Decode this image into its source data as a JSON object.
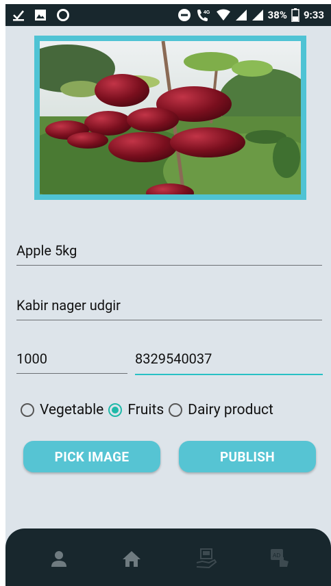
{
  "status_bar": {
    "battery_percent": "38%",
    "time": "9:33",
    "network": "4G",
    "icons_left": [
      "checkbox-download-icon",
      "image-icon",
      "circle-icon"
    ],
    "icons_right": [
      "do-not-disturb-icon",
      "call-4g-icon",
      "wifi-icon",
      "signal-icon",
      "signal-icon-2",
      "battery-icon"
    ]
  },
  "product_image": {
    "icon": "apple-photo"
  },
  "form": {
    "title_value": "Apple 5kg",
    "address_value": "Kabir nager udgir",
    "price_value": "1000",
    "phone_value": "8329540037"
  },
  "categories": {
    "options": [
      "Vegetable",
      "Fruits",
      "Dairy product"
    ],
    "selected": "Fruits"
  },
  "buttons": {
    "pick_image": "PICK IMAGE",
    "publish": "PUBLISH"
  },
  "bottom_nav": {
    "items": [
      "person-icon",
      "home-icon",
      "sell-hand-icon",
      "ad-touch-icon"
    ]
  },
  "colors": {
    "accent": "#56c4d3",
    "radio_checked": "#1fb9a9",
    "dark_bar": "#18272d",
    "background": "#dde4ea"
  }
}
